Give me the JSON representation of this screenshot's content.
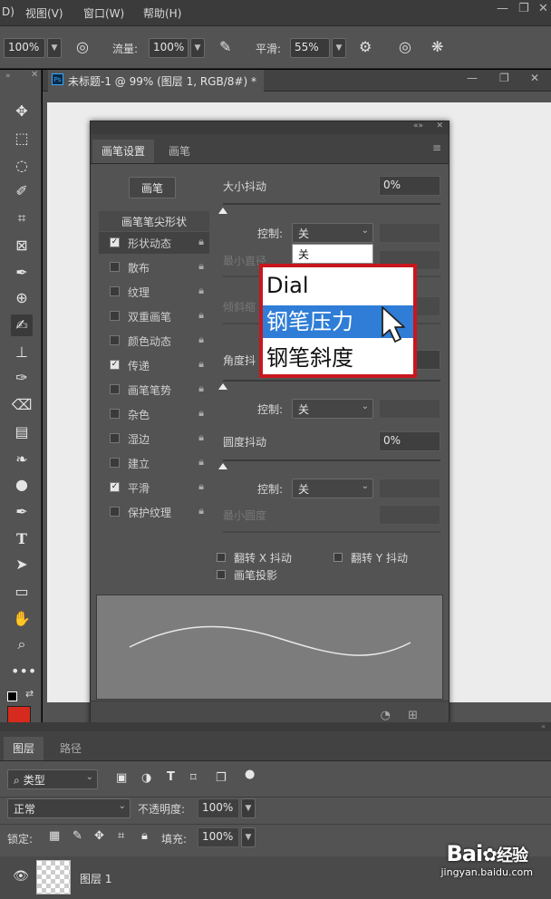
{
  "menubar": {
    "items": [
      "D)",
      "视图(V)",
      "窗口(W)",
      "帮助(H)"
    ],
    "window_controls": [
      "—",
      "❐",
      "✕"
    ]
  },
  "options": {
    "opacity_value": "100%",
    "flow_label": "流量:",
    "flow_value": "100%",
    "smooth_label": "平滑:",
    "smooth_value": "55%"
  },
  "document": {
    "tab_title": "未标题-1 @ 99% (图层 1, RGB/8#) *",
    "ps_badge": "Ps"
  },
  "brush_panel": {
    "tabs": [
      "画笔设置",
      "画笔"
    ],
    "brush_button": "画笔",
    "tip_shape": "画笔笔尖形状",
    "items": [
      {
        "label": "形状动态",
        "checked": true
      },
      {
        "label": "散布",
        "checked": false
      },
      {
        "label": "纹理",
        "checked": false
      },
      {
        "label": "双重画笔",
        "checked": false
      },
      {
        "label": "颜色动态",
        "checked": false
      },
      {
        "label": "传递",
        "checked": true
      },
      {
        "label": "画笔笔势",
        "checked": false
      },
      {
        "label": "杂色",
        "checked": false
      },
      {
        "label": "湿边",
        "checked": false
      },
      {
        "label": "建立",
        "checked": false
      },
      {
        "label": "平滑",
        "checked": true
      },
      {
        "label": "保护纹理",
        "checked": false
      }
    ],
    "size_jitter_label": "大小抖动",
    "size_jitter_value": "0%",
    "control_label": "控制:",
    "control_value": "关",
    "min_diameter_label": "最小直径",
    "tilt_scale_label": "倾斜缩",
    "angle_jitter_label": "角度抖",
    "control2_value": "关",
    "roundness_jitter_label": "圆度抖动",
    "roundness_jitter_value": "0%",
    "control3_value": "关",
    "min_roundness_label": "最小圆度",
    "flip_x": "翻转 X 抖动",
    "flip_y": "翻转 Y 抖动",
    "brush_projection": "画笔投影"
  },
  "dropdown": {
    "current": "关",
    "options": [
      "Dial",
      "钢笔压力",
      "钢笔斜度"
    ],
    "highlighted": "钢笔压力"
  },
  "layers": {
    "tabs": [
      "图层",
      "路径"
    ],
    "filter_label": "类型",
    "blend_mode": "正常",
    "opacity_label": "不透明度:",
    "opacity_value": "100%",
    "lock_label": "锁定:",
    "fill_label": "填充:",
    "fill_value": "100%",
    "layer_name": "图层 1"
  },
  "watermark": {
    "brand": "Bai",
    "brand2": "经验",
    "url": "jingyan.baidu.com"
  },
  "colors": {
    "accent_highlight": "#2f7dd6",
    "callout_border": "#c8161d",
    "foreground_swatch": "#d62a1e"
  }
}
